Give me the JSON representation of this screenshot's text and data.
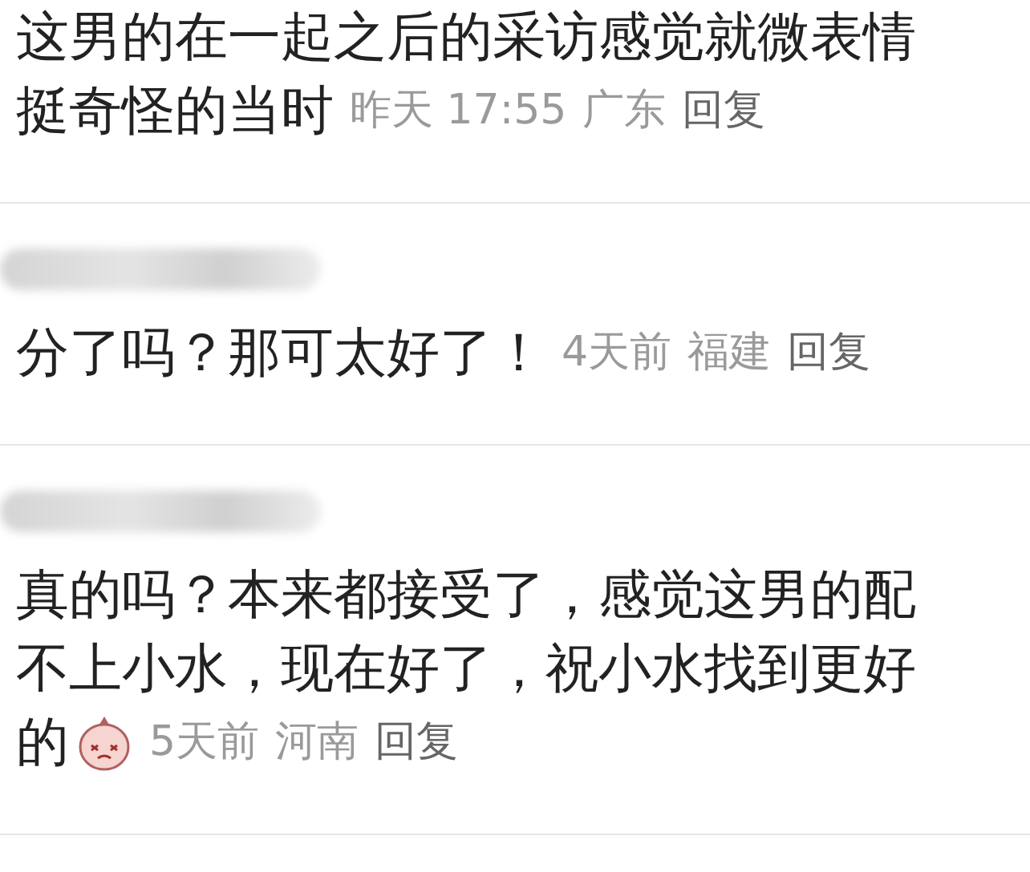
{
  "comments": [
    {
      "name_blurred": false,
      "lines": [
        "这男的在一起之后的采访感觉就微表情",
        "挺奇怪的当时"
      ],
      "sticker": false,
      "time": "昨天 17:55",
      "location": "广东",
      "reply": "回复"
    },
    {
      "name_blurred": true,
      "lines": [
        "分了吗？那可太好了！"
      ],
      "sticker": false,
      "time": "4天前",
      "location": "福建",
      "reply": "回复"
    },
    {
      "name_blurred": true,
      "lines": [
        "真的吗？本来都接受了，感觉这男的配",
        "不上小水，现在好了，祝小水找到更好",
        "的"
      ],
      "sticker": true,
      "time": "5天前",
      "location": "河南",
      "reply": "回复"
    }
  ]
}
